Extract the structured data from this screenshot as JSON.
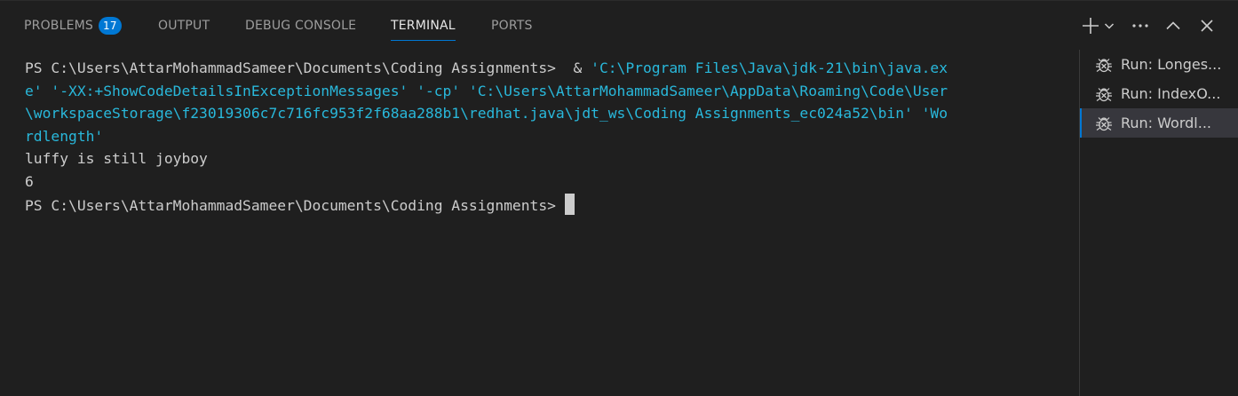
{
  "tabs": [
    {
      "label": "PROBLEMS",
      "badge": "17"
    },
    {
      "label": "OUTPUT"
    },
    {
      "label": "DEBUG CONSOLE"
    },
    {
      "label": "TERMINAL"
    },
    {
      "label": "PORTS"
    }
  ],
  "toolbar": {
    "icons": [
      "plus-icon",
      "chevron-down-icon",
      "more-icon",
      "maximize-icon",
      "close-icon"
    ]
  },
  "terminal": {
    "line1_prompt": "PS C:\\Users\\AttarMohammadSameer\\Documents\\Coding Assignments>  & ",
    "line1_str": "'C:\\Program Files\\Java\\jdk-21\\bin\\java.ex",
    "line2": "e' '-XX:+ShowCodeDetailsInExceptionMessages' '-cp' 'C:\\Users\\AttarMohammadSameer\\AppData\\Roaming\\Code\\User",
    "line3": "\\workspaceStorage\\f23019306c7c716fc953f2f68aa288b1\\redhat.java\\jdt_ws\\Coding Assignments_ec024a52\\bin' 'Wo",
    "line4": "rdlength'",
    "line5": "luffy is still joyboy",
    "line6": "6",
    "line7_prompt": "PS C:\\Users\\AttarMohammadSameer\\Documents\\Coding Assignments> "
  },
  "terminal_list": [
    {
      "label": "Run: Longes...",
      "icon": "debug-icon",
      "selected": false
    },
    {
      "label": "Run: IndexO...",
      "icon": "debug-icon",
      "selected": false
    },
    {
      "label": "Run: Wordl...",
      "icon": "debug-icon",
      "selected": true
    }
  ],
  "colors": {
    "background": "#1f1f1f",
    "accent": "#0078d4",
    "string": "#29b8db",
    "text": "#cccccc"
  }
}
